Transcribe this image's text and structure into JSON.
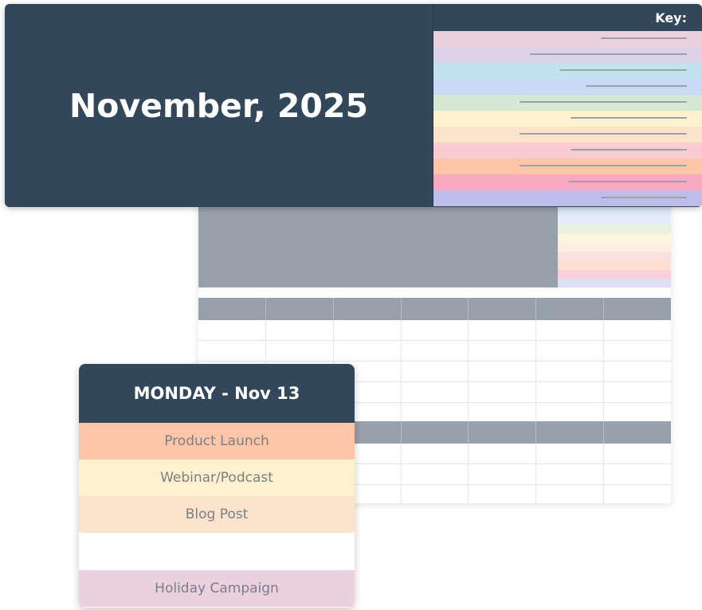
{
  "header": {
    "month_title": "November, 2025",
    "key_label": "Key:",
    "background_color": "#33475b"
  },
  "key_items": [
    {
      "color": "#ebd0dd",
      "line_length": 0.34
    },
    {
      "color": "#dcd3e8",
      "line_length": 0.62
    },
    {
      "color": "#c1e2ef",
      "line_length": 0.5
    },
    {
      "color": "#cadaf6",
      "line_length": 0.4
    },
    {
      "color": "#d6e8d3",
      "line_length": 0.66
    },
    {
      "color": "#fef1cd",
      "line_length": 0.46
    },
    {
      "color": "#fce3cc",
      "line_length": 0.66
    },
    {
      "color": "#f8ccd1",
      "line_length": 0.46
    },
    {
      "color": "#fec6a9",
      "line_length": 0.66
    },
    {
      "color": "#f9aac1",
      "line_length": 0.47
    },
    {
      "color": "#bcbde8",
      "line_length": 0.34
    }
  ],
  "sheet": {
    "stripe_colors": [
      "#dfeaf8",
      "#e4eef9",
      "#e9f1df",
      "#fdf5dc",
      "#fdeee1",
      "#fbe0e2",
      "#fde0d2",
      "#fbd0dd",
      "#e1dff3"
    ]
  },
  "day_card": {
    "title": "MONDAY - Nov 13",
    "events": [
      {
        "label": "Product Launch",
        "color": "#fec6a9"
      },
      {
        "label": "Webinar/Podcast",
        "color": "#fef1cd"
      },
      {
        "label": "Blog Post",
        "color": "#fce3cc"
      },
      {
        "label": "",
        "color": "#ffffff"
      },
      {
        "label": "Holiday Campaign",
        "color": "#ebd0dd"
      }
    ]
  }
}
